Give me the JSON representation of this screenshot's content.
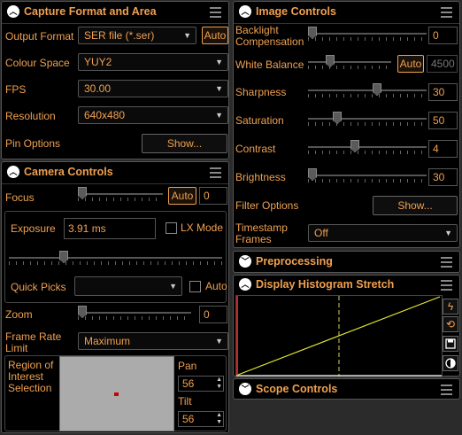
{
  "capture": {
    "title": "Capture Format and Area",
    "output_format_label": "Output Format",
    "output_format_value": "SER file (*.ser)",
    "output_auto": "Auto",
    "colour_space_label": "Colour Space",
    "colour_space_value": "YUY2",
    "fps_label": "FPS",
    "fps_value": "30.00",
    "resolution_label": "Resolution",
    "resolution_value": "640x480",
    "pin_label": "Pin Options",
    "pin_button": "Show..."
  },
  "camera": {
    "title": "Camera Controls",
    "focus_label": "Focus",
    "focus_auto": "Auto",
    "focus_value": "0",
    "exposure_label": "Exposure",
    "exposure_value": "3.91 ms",
    "lx_mode": "LX Mode",
    "quick_picks_label": "Quick Picks",
    "quick_picks_auto": "Auto",
    "zoom_label": "Zoom",
    "zoom_value": "0",
    "frame_rate_label": "Frame Rate Limit",
    "frame_rate_value": "Maximum",
    "roi_label": "Region of Interest Selection",
    "pan_label": "Pan",
    "pan_value": "56",
    "tilt_label": "Tilt",
    "tilt_value": "56"
  },
  "image": {
    "title": "Image Controls",
    "backlight_label": "Backlight Compensation",
    "backlight_value": "0",
    "white_balance_label": "White Balance",
    "white_balance_auto": "Auto",
    "white_balance_value": "4500",
    "sharpness_label": "Sharpness",
    "sharpness_value": "30",
    "saturation_label": "Saturation",
    "saturation_value": "50",
    "contrast_label": "Contrast",
    "contrast_value": "4",
    "brightness_label": "Brightness",
    "brightness_value": "30",
    "filter_label": "Filter Options",
    "filter_button": "Show...",
    "timestamp_label": "Timestamp Frames",
    "timestamp_value": "Off"
  },
  "preprocessing": {
    "title": "Preprocessing"
  },
  "histogram": {
    "title": "Display Histogram Stretch",
    "tools": [
      "lightning-icon",
      "reset-icon",
      "save-icon",
      "contrast-icon"
    ]
  },
  "scope": {
    "title": "Scope Controls"
  },
  "colors": {
    "accent": "#f0a050",
    "panel_bg": "#000000",
    "window_bg": "#2b2b2b",
    "curve": "#e8e830"
  }
}
